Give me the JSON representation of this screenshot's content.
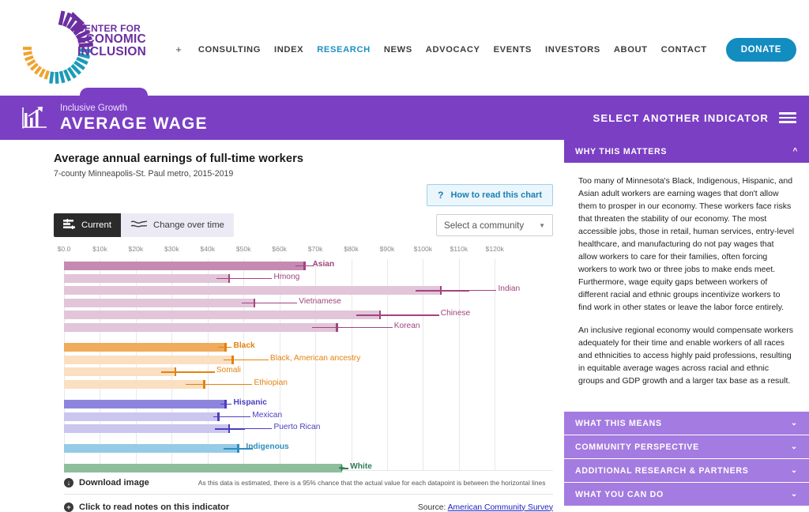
{
  "nav": {
    "plus": "+",
    "items": [
      {
        "label": "CONSULTING",
        "active": false
      },
      {
        "label": "INDEX",
        "active": false
      },
      {
        "label": "RESEARCH",
        "active": true
      },
      {
        "label": "NEWS",
        "active": false
      },
      {
        "label": "ADVOCACY",
        "active": false
      },
      {
        "label": "EVENTS",
        "active": false
      },
      {
        "label": "INVESTORS",
        "active": false
      },
      {
        "label": "ABOUT",
        "active": false
      },
      {
        "label": "CONTACT",
        "active": false
      }
    ],
    "donate": "DONATE"
  },
  "logo": {
    "line1": "CENTER FOR",
    "line2": "ECONOMIC",
    "line3": "INCLUSION",
    "purple": "#6b2fa0",
    "teal": "#1b9bb8",
    "orange": "#f0a22e"
  },
  "banner": {
    "eyebrow": "Inclusive Growth",
    "title": "AVERAGE WAGE",
    "select_indicator": "SELECT ANOTHER INDICATOR",
    "color": "#7b3fc4"
  },
  "chart_header": {
    "title": "Average annual earnings of full-time workers",
    "subtitle": "7-county Minneapolis-St. Paul metro, 2015-2019",
    "how_to_read": "How to read this chart",
    "how_to_read_mark": "?",
    "toggle_current": "Current",
    "toggle_change": "Change over time",
    "community_placeholder": "Select a community"
  },
  "chart_data": {
    "type": "bar",
    "title": "Average annual earnings of full-time workers",
    "subtitle": "7-county Minneapolis-St. Paul metro, 2015-2019",
    "xlabel": "",
    "ylabel": "",
    "xlim": [
      0,
      125000
    ],
    "grid": true,
    "tick_labels": [
      "$0.0",
      "$10k",
      "$20k",
      "$30k",
      "$40k",
      "$50k",
      "$60k",
      "$70k",
      "$80k",
      "$90k",
      "$100k",
      "$110k",
      "$120k"
    ],
    "tick_values": [
      0,
      10000,
      20000,
      30000,
      40000,
      50000,
      60000,
      70000,
      80000,
      90000,
      100000,
      110000,
      120000
    ],
    "note": "As this data is estimated, there is a 95% chance that the actual value for each datapoint is between the horizontal lines",
    "groups": [
      {
        "name": "Asian",
        "color": "#a1457f",
        "bar_primary": "#c58ab2",
        "bar_secondary": "#e2c5d8",
        "bars": [
          {
            "label": "Asian",
            "value": 67000,
            "low": 64500,
            "high": 69500,
            "primary": true
          },
          {
            "label": "Hmong",
            "value": 46000,
            "low": 42500,
            "high": 50500,
            "primary": false
          },
          {
            "label": "Indian",
            "value": 105000,
            "low": 98000,
            "high": 113000,
            "primary": false
          },
          {
            "label": "Vietnamese",
            "value": 53000,
            "low": 49500,
            "high": 57500,
            "primary": false
          },
          {
            "label": "Chinese",
            "value": 88000,
            "low": 81500,
            "high": 97000,
            "primary": false
          },
          {
            "label": "Korean",
            "value": 76000,
            "low": 69000,
            "high": 84000,
            "primary": false
          }
        ]
      },
      {
        "name": "Black",
        "color": "#e3820f",
        "bar_primary": "#f0ab5c",
        "bar_secondary": "#fadfc0",
        "bars": [
          {
            "label": "Black",
            "value": 45000,
            "low": 43000,
            "high": 46500,
            "primary": true
          },
          {
            "label": "Black, American ancestry",
            "value": 47000,
            "low": 44500,
            "high": 49500,
            "primary": false
          },
          {
            "label": "Somali",
            "value": 31000,
            "low": 27000,
            "high": 34500,
            "primary": false
          },
          {
            "label": "Ethiopian",
            "value": 39000,
            "low": 34000,
            "high": 45000,
            "primary": false
          }
        ]
      },
      {
        "name": "Hispanic",
        "color": "#4a3fc0",
        "bar_primary": "#8d85dd",
        "bar_secondary": "#cac6ef",
        "bars": [
          {
            "label": "Hispanic",
            "value": 45000,
            "low": 43500,
            "high": 46500,
            "primary": true
          },
          {
            "label": "Mexican",
            "value": 43000,
            "low": 41500,
            "high": 44500,
            "primary": false
          },
          {
            "label": "Puerto Rican",
            "value": 46000,
            "low": 42000,
            "high": 50500,
            "primary": false
          }
        ]
      },
      {
        "name": "Indigenous",
        "color": "#2f8ebd",
        "bar_primary": "#95cbe6",
        "bar_secondary": "#c5e3f2",
        "bars": [
          {
            "label": "Indigenous",
            "value": 48500,
            "low": 44500,
            "high": 52500,
            "primary": true
          }
        ]
      },
      {
        "name": "White",
        "color": "#2e7d54",
        "bar_primary": "#8fbe9d",
        "bar_secondary": "#c5ddcc",
        "bars": [
          {
            "label": "White",
            "value": 77500,
            "low": 77000,
            "high": 78000,
            "primary": true
          }
        ]
      }
    ]
  },
  "chart_footer": {
    "download": "Download image",
    "note": "As this data is estimated, there is a 95% chance that the actual value for each datapoint is between the horizontal lines",
    "notes_link": "Click to read notes on this indicator",
    "source_label": "Source:",
    "source_link": "American Community Survey"
  },
  "sidebar": {
    "open_section": {
      "title": "WHY THIS MATTERS",
      "paragraphs": [
        "Too many of Minnesota's Black, Indigenous, Hispanic, and Asian adult workers are earning wages that don't allow them to prosper in our economy. These workers face risks that threaten the stability of our economy. The most accessible jobs, those in retail, human services, entry-level healthcare, and manufacturing do not pay wages that allow workers to care for their families, often forcing workers to work two or three jobs to make ends meet. Furthermore, wage equity gaps between workers of different racial and ethnic groups incentivize workers to find work in other states or leave the labor force entirely.",
        "An inclusive regional economy would compensate workers adequately for their time and enable workers of all races and ethnicities to access highly paid professions, resulting in equitable average wages across racial and ethnic groups and GDP growth and a larger tax base as a result."
      ]
    },
    "collapsed_sections": [
      {
        "title": "WHAT THIS MEANS"
      },
      {
        "title": "COMMUNITY PERSPECTIVE"
      },
      {
        "title": "ADDITIONAL RESEARCH & PARTNERS"
      },
      {
        "title": "WHAT YOU CAN DO"
      }
    ]
  }
}
